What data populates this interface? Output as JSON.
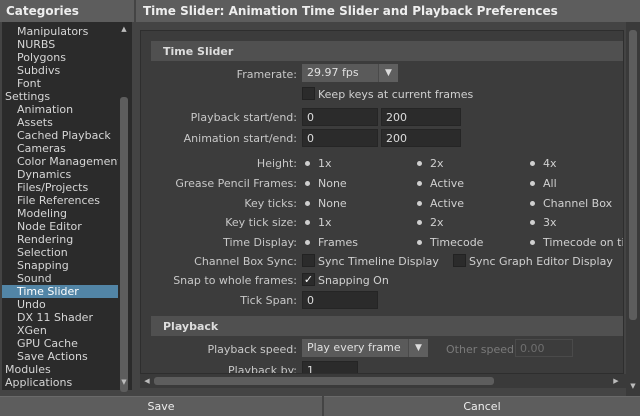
{
  "categories_title": "Categories",
  "tree": [
    {
      "label": "Manipulators",
      "indent": 1
    },
    {
      "label": "NURBS",
      "indent": 1
    },
    {
      "label": "Polygons",
      "indent": 1
    },
    {
      "label": "Subdivs",
      "indent": 1
    },
    {
      "label": "Font",
      "indent": 1
    },
    {
      "label": "Settings",
      "indent": 0
    },
    {
      "label": "Animation",
      "indent": 1
    },
    {
      "label": "Assets",
      "indent": 1
    },
    {
      "label": "Cached Playback",
      "indent": 1
    },
    {
      "label": "Cameras",
      "indent": 1
    },
    {
      "label": "Color Management",
      "indent": 1
    },
    {
      "label": "Dynamics",
      "indent": 1
    },
    {
      "label": "Files/Projects",
      "indent": 1
    },
    {
      "label": "File References",
      "indent": 1
    },
    {
      "label": "Modeling",
      "indent": 1
    },
    {
      "label": "Node Editor",
      "indent": 1
    },
    {
      "label": "Rendering",
      "indent": 1
    },
    {
      "label": "Selection",
      "indent": 1
    },
    {
      "label": "Snapping",
      "indent": 1
    },
    {
      "label": "Sound",
      "indent": 1
    },
    {
      "label": "Time Slider",
      "indent": 1,
      "selected": true
    },
    {
      "label": "Undo",
      "indent": 1
    },
    {
      "label": "DX 11 Shader",
      "indent": 1
    },
    {
      "label": "XGen",
      "indent": 1
    },
    {
      "label": "GPU Cache",
      "indent": 1
    },
    {
      "label": "Save Actions",
      "indent": 1
    },
    {
      "label": "Modules",
      "indent": 0
    },
    {
      "label": "Applications",
      "indent": 0
    }
  ],
  "panel_title": "Time Slider: Animation Time Slider and Playback Preferences",
  "time_slider": {
    "section": "Time Slider",
    "framerate_label": "Framerate:",
    "framerate_value": "29.97 fps",
    "keep_keys_label": "Keep keys at current frames",
    "playback_label": "Playback start/end:",
    "playback_start": "0",
    "playback_end": "200",
    "animation_label": "Animation start/end:",
    "animation_start": "0",
    "animation_end": "200",
    "height_label": "Height:",
    "height_opts": [
      "1x",
      "2x",
      "4x"
    ],
    "grease_label": "Grease Pencil Frames:",
    "grease_opts": [
      "None",
      "Active",
      "All"
    ],
    "keyticks_label": "Key ticks:",
    "keyticks_opts": [
      "None",
      "Active",
      "Channel Box"
    ],
    "ticksize_label": "Key tick size:",
    "ticksize_opts": [
      "1x",
      "2x",
      "3x"
    ],
    "display_label": "Time Display:",
    "display_opts": [
      "Frames",
      "Timecode",
      "Timecode on time"
    ],
    "channelbox_label": "Channel Box Sync:",
    "sync_timeline_label": "Sync Timeline Display",
    "sync_graph_label": "Sync Graph Editor Display",
    "snap_label": "Snap to whole frames:",
    "snap_value": "Snapping On",
    "tickspan_label": "Tick Span:",
    "tickspan_value": "0"
  },
  "playback": {
    "section": "Playback",
    "speed_label": "Playback speed:",
    "speed_value": "Play every frame",
    "other_label": "Other speed:",
    "other_value": "0.00",
    "by_label": "Playback by:",
    "by_value": "1"
  },
  "buttons": {
    "save": "Save",
    "cancel": "Cancel"
  }
}
